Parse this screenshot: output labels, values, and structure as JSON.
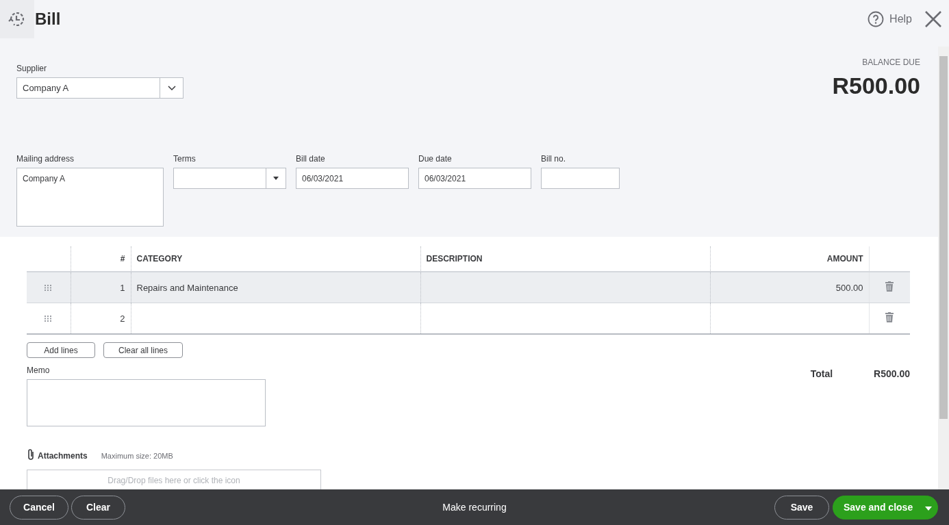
{
  "header": {
    "title": "Bill",
    "help": "Help"
  },
  "supplier": {
    "label": "Supplier",
    "value": "Company A"
  },
  "balance": {
    "label": "BALANCE DUE",
    "amount": "R500.00"
  },
  "fields": [
    {
      "kind": "textarea",
      "label": "Mailing address",
      "value": "Company A"
    },
    {
      "kind": "select",
      "label": "Terms"
    },
    {
      "kind": "text",
      "label": "Bill date",
      "value": "06/03/2021"
    },
    {
      "kind": "text",
      "label": "Due date",
      "value": "06/03/2021"
    },
    {
      "kind": "text",
      "label": "Bill no."
    }
  ],
  "table": {
    "columns": [
      "#",
      "CATEGORY",
      "DESCRIPTION",
      "AMOUNT"
    ],
    "rows": [
      {
        "number": "1",
        "category": "Repairs and Maintenance",
        "amount": "500.00",
        "selected": true
      },
      {
        "number": "2",
        "selected": false
      }
    ]
  },
  "line_buttons": [
    "Add lines",
    "Clear all lines"
  ],
  "total": {
    "label": "Total",
    "amount": "R500.00"
  },
  "memo": {
    "label": "Memo"
  },
  "attachments": {
    "label": "Attachments",
    "note": "Maximum size: 20MB",
    "drop_hint": "Drag/Drop files here or click the icon"
  },
  "footer": {
    "left": [
      "Cancel",
      "Clear"
    ],
    "center": "Make recurring",
    "save": "Save",
    "primary": "Save and close"
  }
}
